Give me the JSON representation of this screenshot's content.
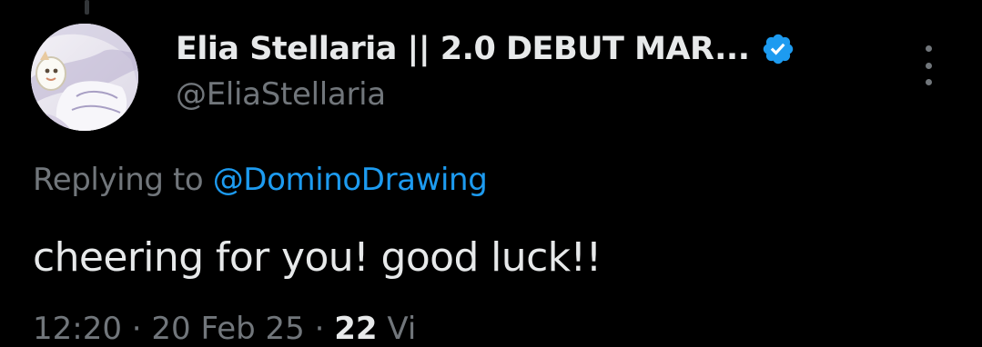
{
  "tweet": {
    "author": {
      "display_name": "Elia Stellaria || 2.0 DEBUT MAR...",
      "handle": "@EliaStellaria",
      "verified": true,
      "avatar_icon": "anime-avatar"
    },
    "reply": {
      "prefix": "Replying to ",
      "mention": "@DominoDrawing"
    },
    "text": "cheering for you! good luck!!",
    "meta": {
      "time": "12:20",
      "separator": "·",
      "date": "20 Feb 25",
      "views_count": "22",
      "views_label": "Vi"
    },
    "more_icon": "more-vertical-icon"
  },
  "colors": {
    "background": "#000000",
    "primary_text": "#e7e9ea",
    "secondary_text": "#71767b",
    "accent": "#1d9bf0"
  }
}
